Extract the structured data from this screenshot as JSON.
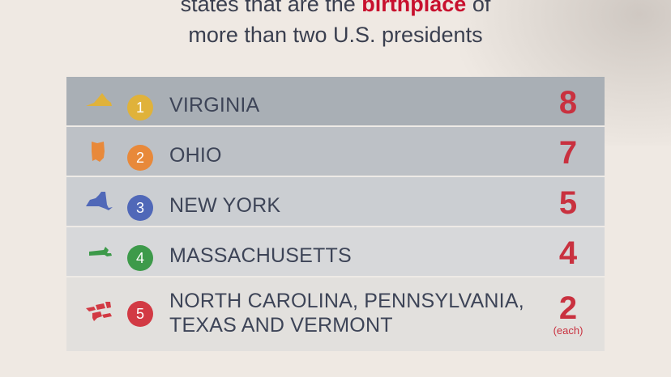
{
  "header": {
    "line1_pre": "states that are the ",
    "line1_highlight": "birthplace",
    "line1_post": " of",
    "line2": "more than two U.S. presidents"
  },
  "colors": {
    "highlight": "#c8102e",
    "count": "#c9313f",
    "rank1": "#e0b23a",
    "rank2": "#e8893a",
    "rank3": "#5068b8",
    "rank4": "#3d9a4a",
    "rank5": "#d23a44"
  },
  "rows": [
    {
      "rank": "1",
      "state": "VIRGINIA",
      "count": "8",
      "icon": "virginia-shape-icon"
    },
    {
      "rank": "2",
      "state": "OHIO",
      "count": "7",
      "icon": "ohio-shape-icon"
    },
    {
      "rank": "3",
      "state": "NEW YORK",
      "count": "5",
      "icon": "new-york-shape-icon"
    },
    {
      "rank": "4",
      "state": "MASSACHUSETTS",
      "count": "4",
      "icon": "massachusetts-shape-icon"
    },
    {
      "rank": "5",
      "state_line1": "NORTH CAROLINA, PENNSYLVANIA,",
      "state_line2": "TEXAS AND VERMONT",
      "count": "2",
      "count_note": "(each)",
      "icon": "multi-state-shapes-icon"
    }
  ]
}
